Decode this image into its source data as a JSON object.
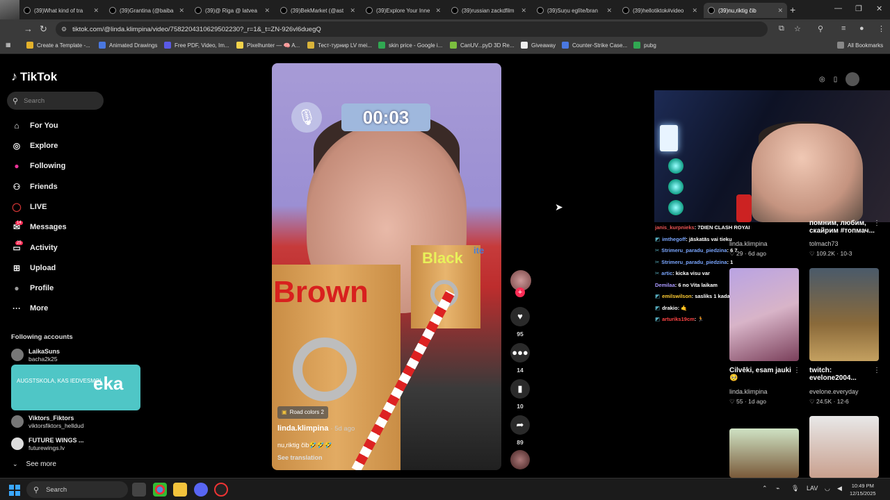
{
  "browser": {
    "tabs": [
      {
        "label": "(39)What kind of tra"
      },
      {
        "label": "(39)Grantina (@baiba"
      },
      {
        "label": "(39)@ Riga @ latvea"
      },
      {
        "label": "(39)BekMarket (@ast"
      },
      {
        "label": "(39)Explore Your Inne"
      },
      {
        "label": "(39)russian zackdfilm"
      },
      {
        "label": "(39)Suņu eglīte/bran"
      },
      {
        "label": "(39)hellotiktok#video"
      },
      {
        "label": "(39)nu,riktig čib"
      }
    ],
    "url": "tiktok.com/@linda.klimpina/video/7582204310629502230?_r=1&_t=ZN-926vl6duegQ",
    "bookmarks": [
      "Create a Template -...",
      "Animated Drawings",
      "Free PDF, Video, Im...",
      "Pixelhunter — 🧠 A...",
      "Тест-турнир LV mei...",
      "skin price - Google i...",
      "CanUV...pyD 3D Re...",
      "Giveaway",
      "Counter-Strike Case...",
      "pubg"
    ],
    "all_bookmarks": "All Bookmarks"
  },
  "tiktok": {
    "logo": "TikTok",
    "search_placeholder": "Search",
    "nav": [
      {
        "label": "For You",
        "icon": "home-icon"
      },
      {
        "label": "Explore",
        "icon": "compass-icon"
      },
      {
        "label": "Following",
        "icon": "following-icon"
      },
      {
        "label": "Friends",
        "icon": "friends-icon"
      },
      {
        "label": "LIVE",
        "icon": "live-icon"
      },
      {
        "label": "Messages",
        "icon": "messages-icon",
        "badge": "14"
      },
      {
        "label": "Activity",
        "icon": "activity-icon",
        "badge": "25"
      },
      {
        "label": "Upload",
        "icon": "upload-icon"
      },
      {
        "label": "Profile",
        "icon": "profile-icon"
      },
      {
        "label": "More",
        "icon": "more-icon"
      }
    ],
    "following_title": "Following accounts",
    "accounts": [
      {
        "name": "LaikaSuns",
        "user": "bacha2k25"
      },
      {
        "name": "Viktors_Fiktors",
        "user": "viktorsfiktors_helldud"
      },
      {
        "name": "FUTURE WINGS ...",
        "user": "futurewings.lv"
      }
    ],
    "ad": {
      "text": "AUGSTSKOLA, KAS IEDVESMO!",
      "logo": "eka"
    },
    "see_more": "See more"
  },
  "video": {
    "timer": "00:03",
    "words": {
      "brown": "Brown",
      "black": "Black",
      "white": "ite"
    },
    "effect": "Road colors 2",
    "author": "linda.klimpina",
    "time_ago": "· 5d ago",
    "caption": "nu,riktig čib🤣🤣🤣",
    "see_translation": "See translation",
    "likes": "95",
    "comments": "14",
    "saves": "10",
    "shares": "89"
  },
  "chat": [
    {
      "user": "janis_kurpnieks",
      "msg": ": 7DIEN CLASH ROYAL MHM"
    },
    {
      "user": "imthegoff",
      "msg": ": jāskatās vai tieku"
    },
    {
      "user": "Strimeru_paradu_piedzina",
      "msg": ": 6 7"
    },
    {
      "user": "Strimeru_paradu_piedzina",
      "msg": ": 1"
    },
    {
      "user": "artic",
      "msg": ": kicka visu var"
    },
    {
      "user": "Demilaa",
      "msg": ": 6 no Vita laikam"
    },
    {
      "user": "emilswilson",
      "msg": ": sasliks 1 kada cope"
    },
    {
      "user": "drakio",
      "msg": ": 🤙"
    },
    {
      "user": "arturiks19cm",
      "msg": ": 🏃"
    }
  ],
  "cards": [
    {
      "title": "помним, любим, скайрим #топмач...",
      "user": "tolmach73",
      "likes": "109.2K",
      "date": "10-3"
    },
    {
      "title": "",
      "user": "linda.klimpina",
      "likes": "29",
      "date": "6d ago"
    },
    {
      "title": "Cilvēki, esam jauki 🥺",
      "user": "linda.klimpina",
      "likes": "55",
      "date": "1d ago"
    },
    {
      "title": "twitch: evelone2004...",
      "user": "evelone.everyday",
      "likes": "24.5K",
      "date": "12-6"
    }
  ],
  "taskbar": {
    "search": "Search",
    "lang": "LAV",
    "time": "10:49 PM",
    "date": "12/15/2025"
  }
}
